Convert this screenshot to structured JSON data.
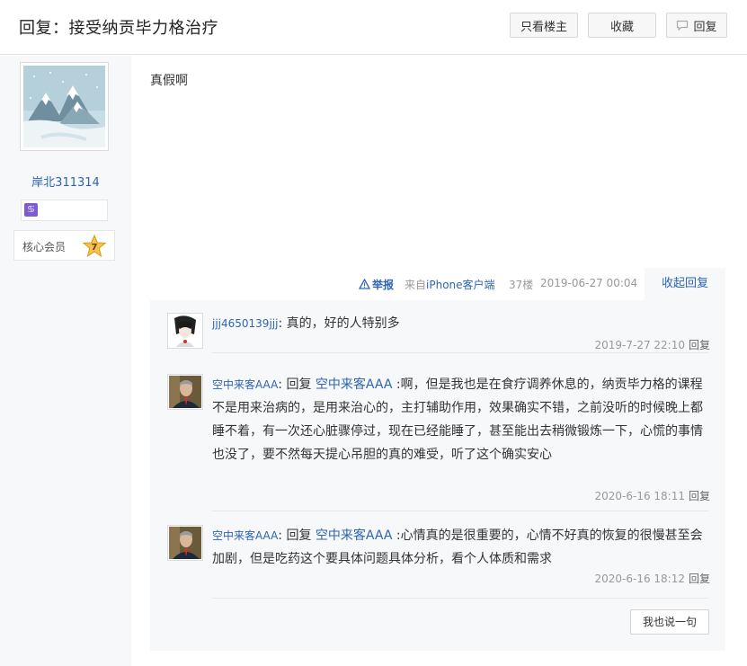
{
  "header": {
    "title": "回复：接受纳贡毕力格治疗",
    "only_op_label": "只看楼主",
    "favorite_label": "收藏",
    "reply_label": "回复"
  },
  "author": {
    "username": "岸北311314",
    "member_label": "核心会员",
    "level": "7"
  },
  "post": {
    "text": "真假啊",
    "report_label": "举报",
    "from_prefix": "来自",
    "client": "iPhone客户端",
    "floor": "37楼",
    "date": "2019-06-27 00:04",
    "fold_label": "收起回复"
  },
  "replies": [
    {
      "user": "jjj4650139jjj",
      "prefix": "",
      "target": "",
      "text": ": 真的，好的人特别多",
      "time": "2019-7-27 22:10",
      "reply_label": "回复"
    },
    {
      "user": "空中来客AAA",
      "prefix": ": 回复 ",
      "target": "空中来客AAA",
      "text": " :啊，但是我也是在食疗调养休息的，纳贡毕力格的课程不是用来治病的，是用来治心的，主打辅助作用，效果确实不错，之前没听的时候晚上都睡不着，有一次还心脏骤停过，现在已经能睡了，甚至能出去稍微锻炼一下，心慌的事情也没了，要不然每天提心吊胆的真的难受，听了这个确实安心",
      "time": "2020-6-16 18:11",
      "reply_label": "回复"
    },
    {
      "user": "空中来客AAA",
      "prefix": ": 回复 ",
      "target": "空中来客AAA",
      "text": " :心情真的是很重要的，心情不好真的恢复的很慢甚至会加剧，但是吃药这个要具体问题具体分析，看个人体质和需求",
      "time": "2020-6-16 18:12",
      "reply_label": "回复"
    }
  ],
  "say_label": "我也说一句",
  "colors": {
    "link_blue": "#2d64b3",
    "panel_bg": "#f7f8fa",
    "meta_gray": "#999999"
  }
}
